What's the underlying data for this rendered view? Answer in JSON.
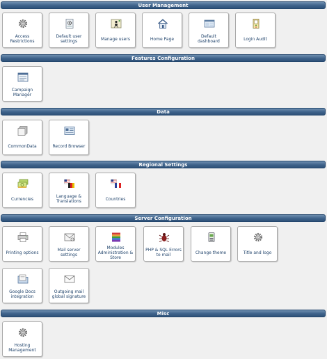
{
  "sections": [
    {
      "title": "User Management",
      "tiles": [
        {
          "label": "Access Restrictions",
          "icon": "gear-icon"
        },
        {
          "label": "Default user settings",
          "icon": "user-settings-icon"
        },
        {
          "label": "Manage users",
          "icon": "manage-users-icon"
        },
        {
          "label": "Home Page",
          "icon": "home-icon"
        },
        {
          "label": "Default dashboard",
          "icon": "dashboard-icon"
        },
        {
          "label": "Login Audit",
          "icon": "login-audit-icon"
        }
      ]
    },
    {
      "title": "Features Configuration",
      "tiles": [
        {
          "label": "Campaign Manager",
          "icon": "campaign-icon"
        }
      ]
    },
    {
      "title": "Data",
      "tiles": [
        {
          "label": "CommonData",
          "icon": "common-data-icon"
        },
        {
          "label": "Record Browser",
          "icon": "record-browser-icon"
        }
      ]
    },
    {
      "title": "Regional Settings",
      "tiles": [
        {
          "label": "Currencies",
          "icon": "currencies-icon"
        },
        {
          "label": "Language & Translations",
          "icon": "flags-icon"
        },
        {
          "label": "Countries",
          "icon": "flags-icon"
        }
      ]
    },
    {
      "title": "Server Configuration",
      "tiles": [
        {
          "label": "Printing options",
          "icon": "printer-icon"
        },
        {
          "label": "Mail server settings",
          "icon": "mail-server-icon"
        },
        {
          "label": "Modules Administration & Store",
          "icon": "modules-icon"
        },
        {
          "label": "PHP & SQL Errors to mail",
          "icon": "bug-icon"
        },
        {
          "label": "Change theme",
          "icon": "theme-icon"
        },
        {
          "label": "Title and logo",
          "icon": "gear-icon"
        },
        {
          "label": "Google Docs integration",
          "icon": "google-docs-icon"
        },
        {
          "label": "Outgoing mail global signature",
          "icon": "envelope-icon"
        }
      ]
    },
    {
      "title": "Misc",
      "tiles": [
        {
          "label": "Hosting Management",
          "icon": "gear-icon"
        }
      ]
    }
  ],
  "colors": {
    "header_bg": "#3e628a",
    "header_text": "#ffffff",
    "label_text": "#20436b",
    "page_bg": "#f0f0f0"
  }
}
